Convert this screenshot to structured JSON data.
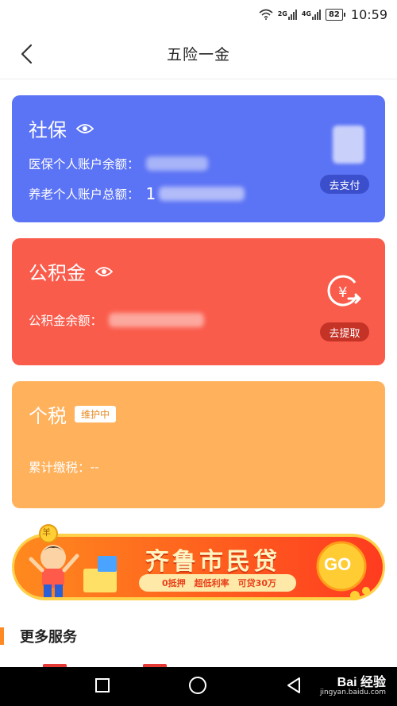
{
  "status": {
    "net1": "2G",
    "net2": "4G",
    "battery": "82",
    "time": "10:59"
  },
  "header": {
    "title": "五险一金",
    "back_icon": "chevron-left-icon"
  },
  "social_insurance": {
    "title": "社保",
    "medical_label": "医保个人账户余额：",
    "pension_label": "养老个人账户总额：",
    "pension_value_prefix": "1",
    "pay_button": "去支付",
    "color": "#5b73f5"
  },
  "housing_fund": {
    "title": "公积金",
    "balance_label": "公积金余额：",
    "withdraw_button": "去提取",
    "color": "#fa5c4c"
  },
  "income_tax": {
    "title": "个税",
    "badge": "维护中",
    "total_label": "累计缴税：",
    "total_value": "--",
    "color": "#ffb15c"
  },
  "banner": {
    "title": "齐鲁市民贷",
    "subtitle": "0抵押　超低利率　可贷30万",
    "go_label": "GO",
    "coin_label": "羊"
  },
  "more_services": {
    "title": "更多服务"
  },
  "watermark": {
    "main": "Bai 经验",
    "sub": "jingyan.baidu.com"
  }
}
